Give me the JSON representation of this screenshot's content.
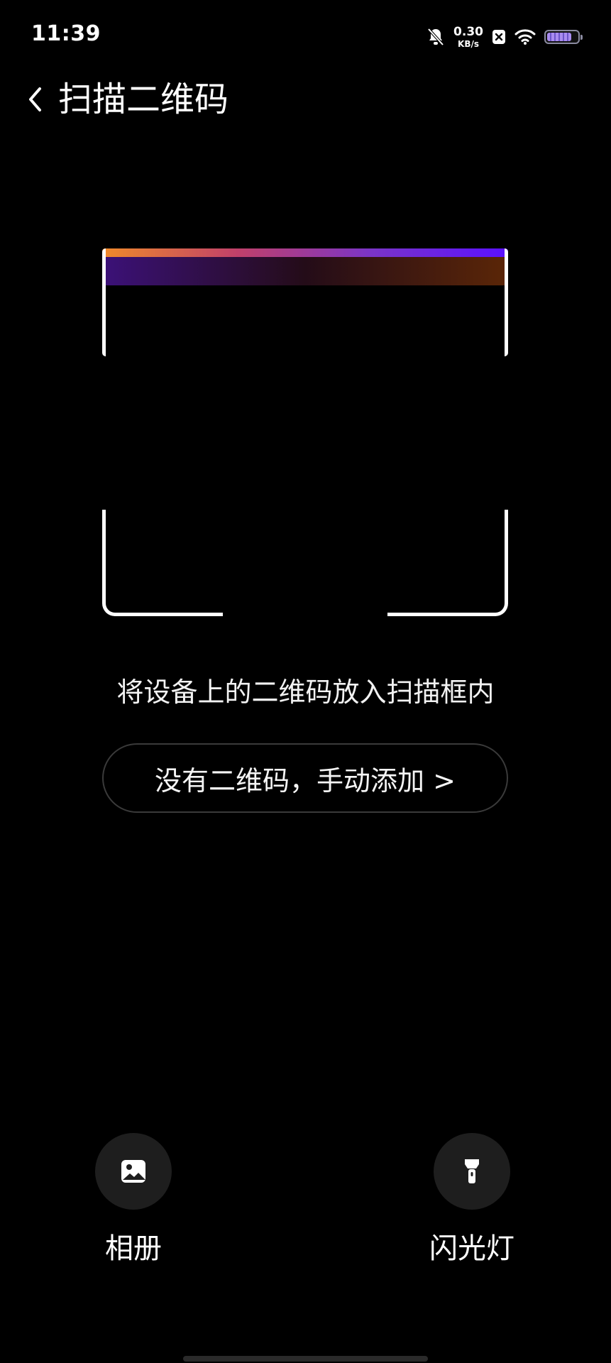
{
  "status_bar": {
    "time": "11:39",
    "net_speed_value": "0.30",
    "net_speed_unit": "KB/s",
    "icons": [
      "mute-bell-icon",
      "close-box-icon",
      "wifi-icon",
      "battery-icon"
    ],
    "battery_level": 0.8
  },
  "header": {
    "title": "扫描二维码",
    "back_icon": "chevron-left-icon"
  },
  "scanner": {
    "hint": "将设备上的二维码放入扫描框内",
    "manual_add_label": "没有二维码，手动添加 >",
    "scan_line_colors": [
      "#f08a2a",
      "#c0406a",
      "#7a34c8",
      "#5a10ff"
    ]
  },
  "actions": {
    "album_label": "相册",
    "album_icon": "image-icon",
    "flash_label": "闪光灯",
    "flash_icon": "flashlight-icon"
  }
}
